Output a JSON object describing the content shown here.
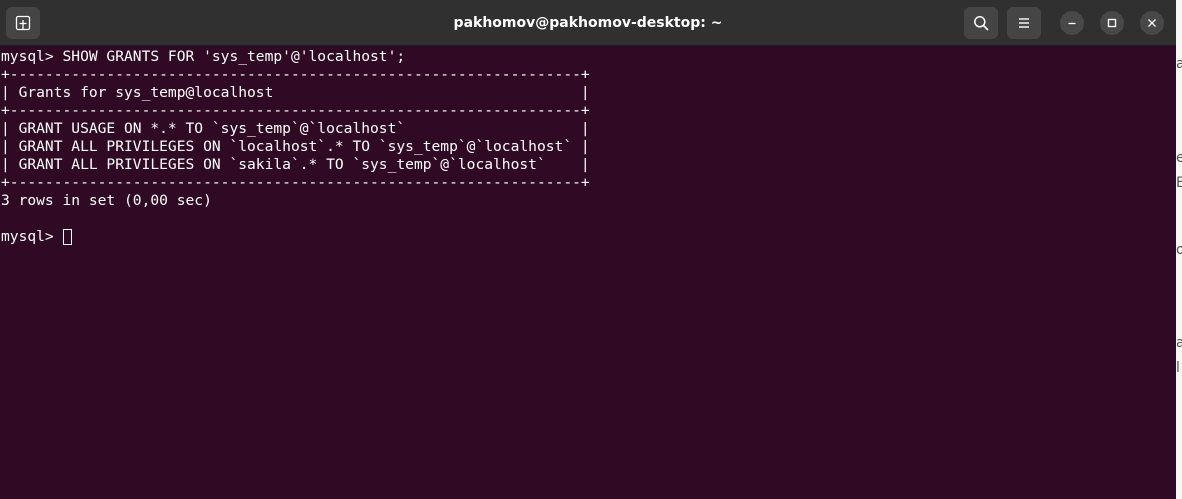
{
  "window": {
    "title": "pakhomov@pakhomov-desktop: ~"
  },
  "icons": {
    "new_tab": "new-tab-icon",
    "search": "search-icon",
    "menu": "hamburger-menu-icon",
    "minimize": "minimize-icon",
    "maximize": "maximize-icon",
    "close": "close-icon"
  },
  "terminal": {
    "lines": [
      "mysql> SHOW GRANTS FOR 'sys_temp'@'localhost';",
      "+-----------------------------------------------------------------+",
      "| Grants for sys_temp@localhost                                   |",
      "+-----------------------------------------------------------------+",
      "| GRANT USAGE ON *.* TO `sys_temp`@`localhost`                    |",
      "| GRANT ALL PRIVILEGES ON `localhost`.* TO `sys_temp`@`localhost` |",
      "| GRANT ALL PRIVILEGES ON `sakila`.* TO `sys_temp`@`localhost`    |",
      "+-----------------------------------------------------------------+",
      "3 rows in set (0,00 sec)",
      ""
    ],
    "prompt": "mysql> "
  },
  "background_window": {
    "fragments": [
      "a",
      "e",
      "E",
      "o",
      "a",
      "l"
    ]
  },
  "colors": {
    "terminal_bg": "#300a24",
    "titlebar_bg": "#303030",
    "text": "#ffffff"
  }
}
